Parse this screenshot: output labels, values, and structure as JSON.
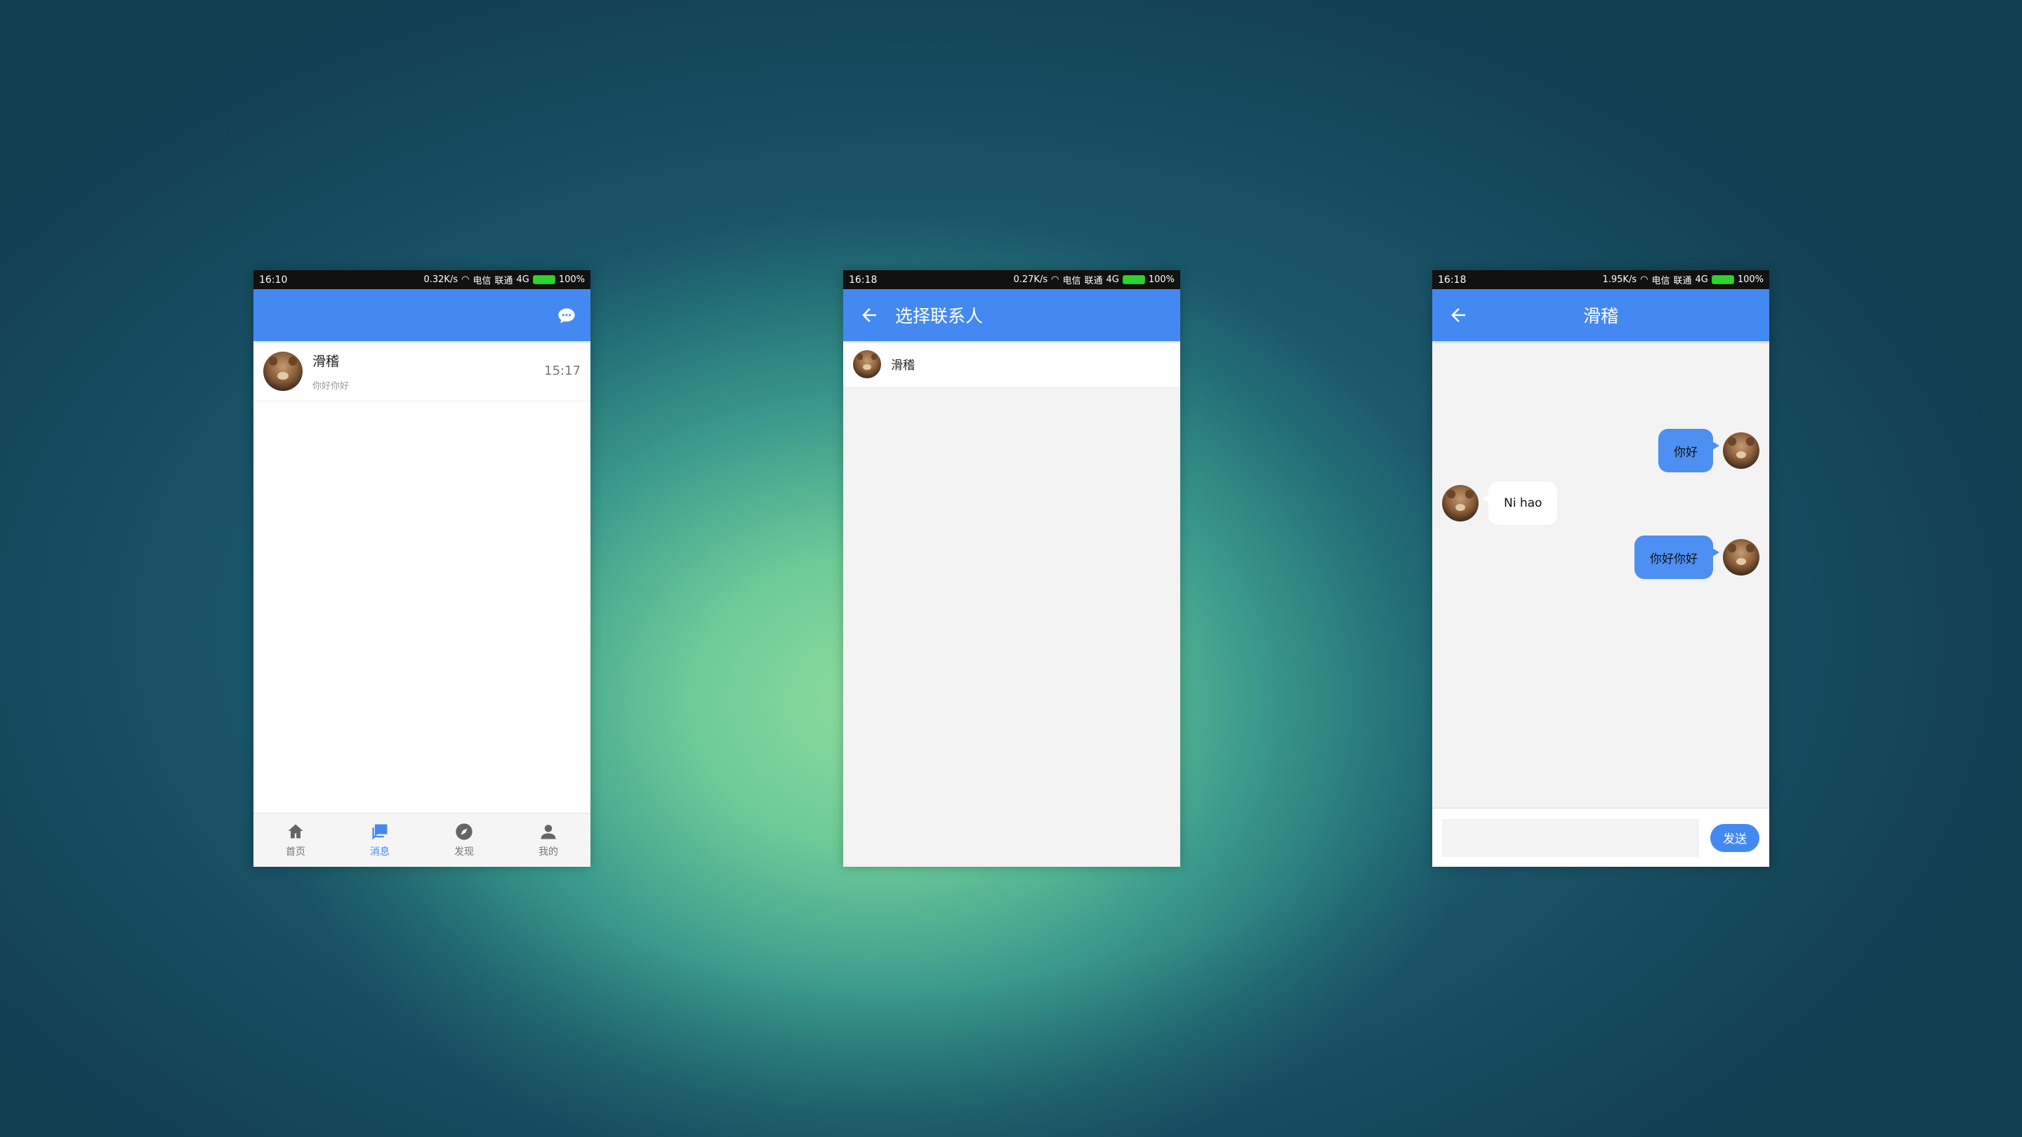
{
  "colors": {
    "accent": "#4489f2",
    "bubble_me": "#4d8ff2",
    "bubble_them": "#ffffff",
    "screen_bg": "#f3f3f3"
  },
  "phone1": {
    "status": {
      "time": "16:10",
      "speed": "0.32K/s",
      "carrier1": "电信",
      "carrier2": "联通",
      "network": "4G",
      "battery": "100%"
    },
    "appbar_icon": "chat-bubble-icon",
    "conversations": [
      {
        "name": "滑稽",
        "preview": "你好你好",
        "time": "15:17"
      }
    ],
    "tabs": [
      {
        "label": "首页",
        "icon": "home-icon"
      },
      {
        "label": "消息",
        "icon": "message-icon"
      },
      {
        "label": "发现",
        "icon": "compass-icon"
      },
      {
        "label": "我的",
        "icon": "person-icon"
      }
    ],
    "active_tab": "消息"
  },
  "phone2": {
    "status": {
      "time": "16:18",
      "speed": "0.27K/s",
      "carrier1": "电信",
      "carrier2": "联通",
      "network": "4G",
      "battery": "100%"
    },
    "title": "选择联系人",
    "contacts": [
      {
        "name": "滑稽"
      }
    ]
  },
  "phone3": {
    "status": {
      "time": "16:18",
      "speed": "1.95K/s",
      "carrier1": "电信",
      "carrier2": "联通",
      "network": "4G",
      "battery": "100%"
    },
    "title": "滑稽",
    "messages": [
      {
        "from": "me",
        "text": "你好"
      },
      {
        "from": "them",
        "text": "Ni hao"
      },
      {
        "from": "me",
        "text": "你好你好"
      }
    ],
    "input_value": "",
    "send_label": "发送"
  }
}
